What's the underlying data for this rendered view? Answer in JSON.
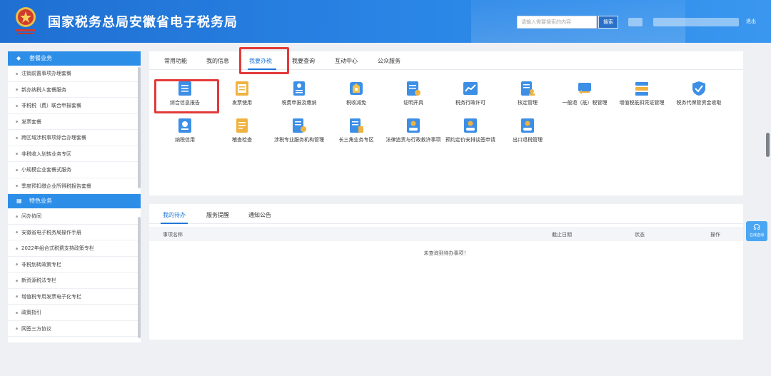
{
  "header": {
    "title": "国家税务总局安徽省电子税务局",
    "search_placeholder": "请输入需要搜索的内容",
    "search_button": "搜索",
    "logout": "退出"
  },
  "sidebar": {
    "section1_title": "套餐业务",
    "section1_items": [
      "注销前置事项办理套餐",
      "新办纳税人套餐服务",
      "非税税（费）联合申报套餐",
      "发票套餐",
      "跨区域涉税事项综合办理套餐",
      "非税收入划转业务专区",
      "小规模企业套餐式服务",
      "季度预扣缴企业所得税报告套餐"
    ],
    "section2_title": "特色业务",
    "section2_items": [
      "问办协同",
      "安徽省电子税务局操作手册",
      "2022年组合式税费支持政策专栏",
      "非税划转政策专栏",
      "新资源税法专栏",
      "增值税专用发票电子化专栏",
      "政策指引",
      "网签三方协议"
    ]
  },
  "tabs": [
    "常用功能",
    "我的信息",
    "我要办税",
    "我要查询",
    "互动中心",
    "公众服务"
  ],
  "services_row1": [
    {
      "label": "综合信息报告"
    },
    {
      "label": "发票使用"
    },
    {
      "label": "税费申报及缴纳"
    },
    {
      "label": "税收减免"
    },
    {
      "label": "证明开具"
    },
    {
      "label": "税务行政许可"
    },
    {
      "label": "核定管理"
    },
    {
      "label": "一般退（抵）税管理"
    },
    {
      "label": "增值税抵扣凭证管理"
    },
    {
      "label": "税务代保管资金收取"
    }
  ],
  "services_row2": [
    {
      "label": "纳税信用"
    },
    {
      "label": "稽查检查"
    },
    {
      "label": "涉税专业服务机构管理"
    },
    {
      "label": "长三角业务专区"
    },
    {
      "label": "法律追责与行政救济事项"
    },
    {
      "label": "预约定价安排谈签申请"
    },
    {
      "label": "出口退税管理"
    }
  ],
  "lower": {
    "tabs": [
      "我的待办",
      "服务提醒",
      "通知公告"
    ],
    "columns": [
      "事项名称",
      "截止日期",
      "状态",
      "操作"
    ],
    "empty": "未查询到待办事项！"
  },
  "chat": {
    "label": "在线咨询"
  },
  "colors": {
    "primary": "#2d8ee8",
    "accent": "#2277d8",
    "highlight": "#e23a3a"
  }
}
